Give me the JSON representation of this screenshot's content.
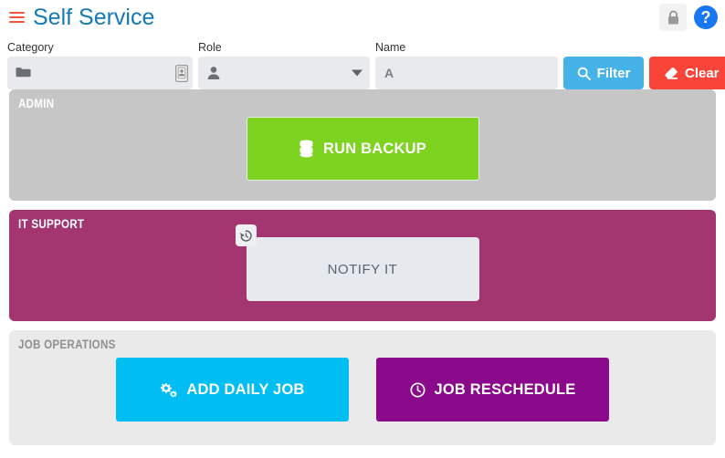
{
  "header": {
    "menu_icon": "hamburger-icon",
    "title": "Self Service",
    "lock_icon": "lock-icon",
    "help_icon": "help-circle-icon",
    "help_label": "?"
  },
  "filters": {
    "category": {
      "label": "Category",
      "value": "",
      "placeholder": "",
      "left_icon": "folder-icon",
      "right_icon": "address-card-icon"
    },
    "role": {
      "label": "Role",
      "value": "",
      "placeholder": "",
      "left_icon": "user-icon",
      "right_icon": "chevron-down-icon",
      "options": []
    },
    "name": {
      "label": "Name",
      "value": "A",
      "placeholder": "A"
    },
    "filter_button": {
      "label": "Filter",
      "icon": "search-icon",
      "color": "#45b2e8"
    },
    "clear_button": {
      "label": "Clear",
      "icon": "eraser-icon",
      "color": "#f9443a"
    }
  },
  "sections": [
    {
      "title": "ADMIN",
      "background": "#c6c6c6",
      "buttons": [
        {
          "label": "RUN BACKUP",
          "icon": "database-icon",
          "color": "#7ed321"
        }
      ]
    },
    {
      "title": "IT SUPPORT",
      "background": "#a33570",
      "buttons": [
        {
          "label": "NOTIFY IT",
          "icon": "history-icon",
          "color": "#e6e9ee"
        }
      ]
    },
    {
      "title": "JOB OPERATIONS",
      "background": "#eaeaea",
      "buttons": [
        {
          "label": "ADD DAILY JOB",
          "icon": "cogs-icon",
          "color": "#00bdf2"
        },
        {
          "label": "JOB RESCHEDULE",
          "icon": "clock-icon",
          "color": "#8b0a8b"
        }
      ]
    }
  ]
}
